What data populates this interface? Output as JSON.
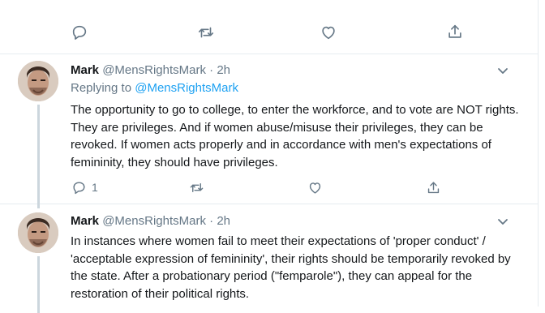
{
  "top_actions": {
    "icons": [
      "reply-icon",
      "retweet-icon",
      "like-icon",
      "share-icon"
    ]
  },
  "tweets": [
    {
      "name": "Mark",
      "handle": "@MensRightsMark",
      "separator": "·",
      "time": "2h",
      "replying_prefix": "Replying to ",
      "replying_handle": "@MensRightsMark",
      "text": "The opportunity to go to college, to enter the workforce, and to vote are NOT rights. They are privileges. And if women abuse/misuse their privileges, they can be revoked. If women acts properly and in accordance with men's expectations of femininity, they should have privileges.",
      "reply_count": "1"
    },
    {
      "name": "Mark",
      "handle": "@MensRightsMark",
      "separator": "·",
      "time": "2h",
      "text": "In instances where women fail to meet their expectations of 'proper conduct' / 'acceptable expression of femininity', their rights should be temporarily revoked by the state. After a probationary period (\"femparole\"), they can appeal for the restoration of their political rights."
    }
  ],
  "colors": {
    "link": "#1da1f2",
    "muted": "#657786",
    "text": "#14171a",
    "border": "#e6ecf0",
    "thread_line": "#ccd6dd"
  }
}
